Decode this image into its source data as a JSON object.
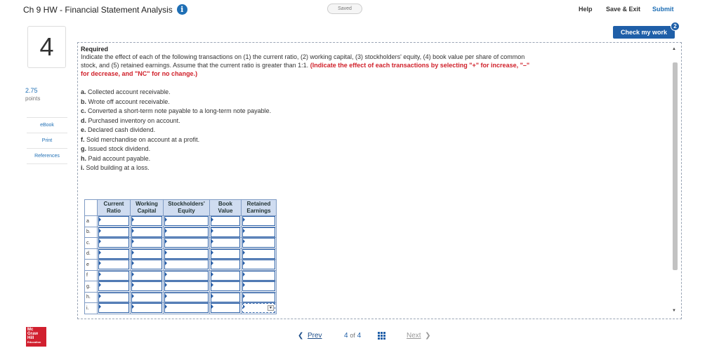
{
  "header": {
    "title": "Ch 9 HW - Financial Statement Analysis",
    "info_icon": "i",
    "status": "Saved",
    "help": "Help",
    "save_exit": "Save & Exit",
    "submit": "Submit"
  },
  "check_work": {
    "label": "Check my work",
    "badge": "2"
  },
  "question": {
    "number": "4",
    "points_value": "2.75",
    "points_label": "points"
  },
  "side_links": [
    "eBook",
    "Print",
    "References"
  ],
  "content": {
    "required_title": "Required",
    "instructions": "Indicate the effect of each of the following transactions on (1) the current ratio, (2) working capital, (3) stockholders' equity, (4) book value per share of common stock, and (5) retained earnings. Assume that the current ratio is greater than 1:1.",
    "instructions_red": "(Indicate the effect of each transactions by selecting \"+\" for increase, \"–\" for decrease, and \"NC\" for no change.)",
    "transactions": [
      {
        "letter": "a.",
        "text": "Collected account receivable."
      },
      {
        "letter": "b.",
        "text": "Wrote off account receivable."
      },
      {
        "letter": "c.",
        "text": "Converted a short-term note payable to a long-term note payable."
      },
      {
        "letter": "d.",
        "text": "Purchased inventory on account."
      },
      {
        "letter": "e.",
        "text": "Declared cash dividend."
      },
      {
        "letter": "f.",
        "text": "Sold merchandise on account at a profit."
      },
      {
        "letter": "g.",
        "text": "Issued stock dividend."
      },
      {
        "letter": "h.",
        "text": "Paid account payable."
      },
      {
        "letter": "i.",
        "text": "Sold building at a loss."
      }
    ]
  },
  "table": {
    "headers": [
      [
        "Current",
        "Ratio"
      ],
      [
        "Working",
        "Capital"
      ],
      [
        "Stockholders'",
        "Equity"
      ],
      [
        "Book",
        "Value"
      ],
      [
        "Retained",
        "Earnings"
      ]
    ],
    "rows": [
      "a",
      "b.",
      "c.",
      "d.",
      "e",
      "f",
      "g.",
      "h.",
      "i."
    ]
  },
  "pagination": {
    "prev": "Prev",
    "current": "4",
    "of": "of",
    "total": "4",
    "next": "Next"
  },
  "logo": {
    "lines": [
      "Mc",
      "Graw",
      "Hill",
      "Education"
    ]
  }
}
